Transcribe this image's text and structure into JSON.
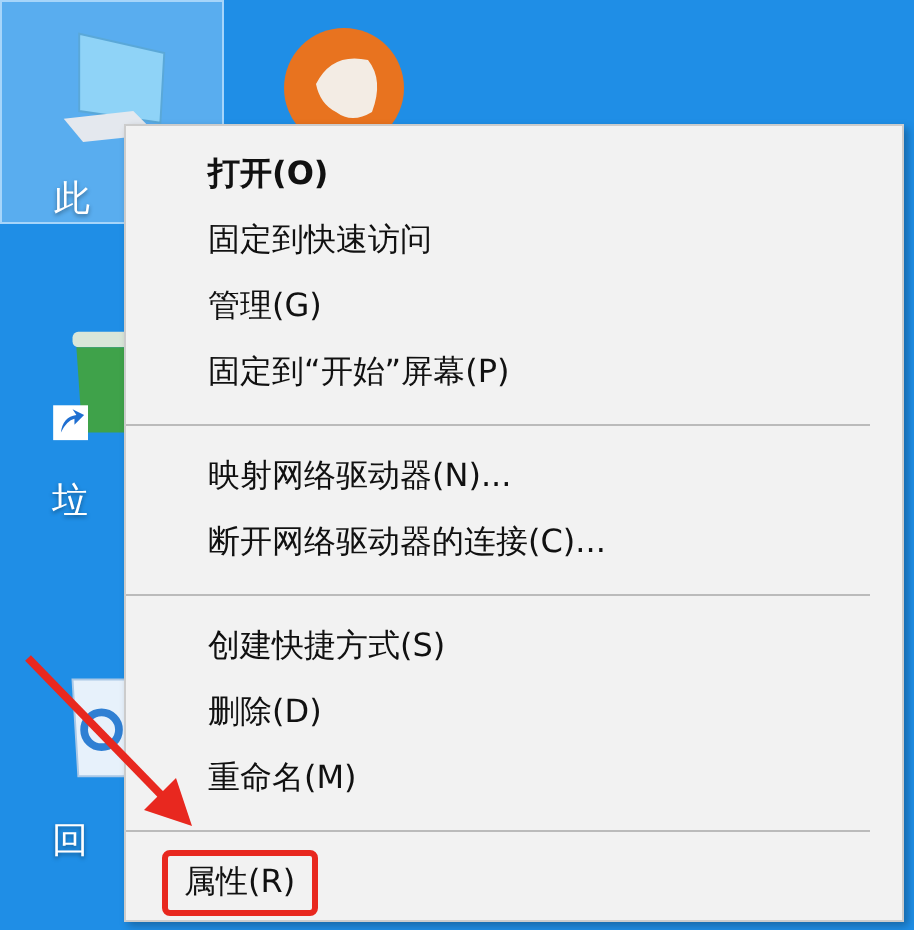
{
  "desktop_icons": [
    {
      "kind": "computer",
      "label": "此",
      "selected": true
    },
    {
      "kind": "app",
      "selected": false
    },
    {
      "kind": "bin",
      "label": "垃",
      "shortcut": true,
      "selected": false
    },
    {
      "kind": "recycle",
      "label": "回",
      "selected": false
    }
  ],
  "context_menu": {
    "items": [
      {
        "kind": "item",
        "label": "打开(O)",
        "default": true,
        "highlighted": false
      },
      {
        "kind": "item",
        "label": "固定到快速访问",
        "default": false,
        "highlighted": false
      },
      {
        "kind": "item",
        "label": "管理(G)",
        "default": false,
        "highlighted": false
      },
      {
        "kind": "item",
        "label": "固定到“开始”屏幕(P)",
        "default": false,
        "highlighted": false
      },
      {
        "kind": "separator"
      },
      {
        "kind": "item",
        "label": "映射网络驱动器(N)...",
        "default": false,
        "highlighted": false
      },
      {
        "kind": "item",
        "label": "断开网络驱动器的连接(C)...",
        "default": false,
        "highlighted": false
      },
      {
        "kind": "separator"
      },
      {
        "kind": "item",
        "label": "创建快捷方式(S)",
        "default": false,
        "highlighted": false
      },
      {
        "kind": "item",
        "label": "删除(D)",
        "default": false,
        "highlighted": false
      },
      {
        "kind": "item",
        "label": "重命名(M)",
        "default": false,
        "highlighted": false
      },
      {
        "kind": "separator"
      },
      {
        "kind": "item",
        "label": "属性(R)",
        "default": false,
        "highlighted": true
      }
    ]
  }
}
